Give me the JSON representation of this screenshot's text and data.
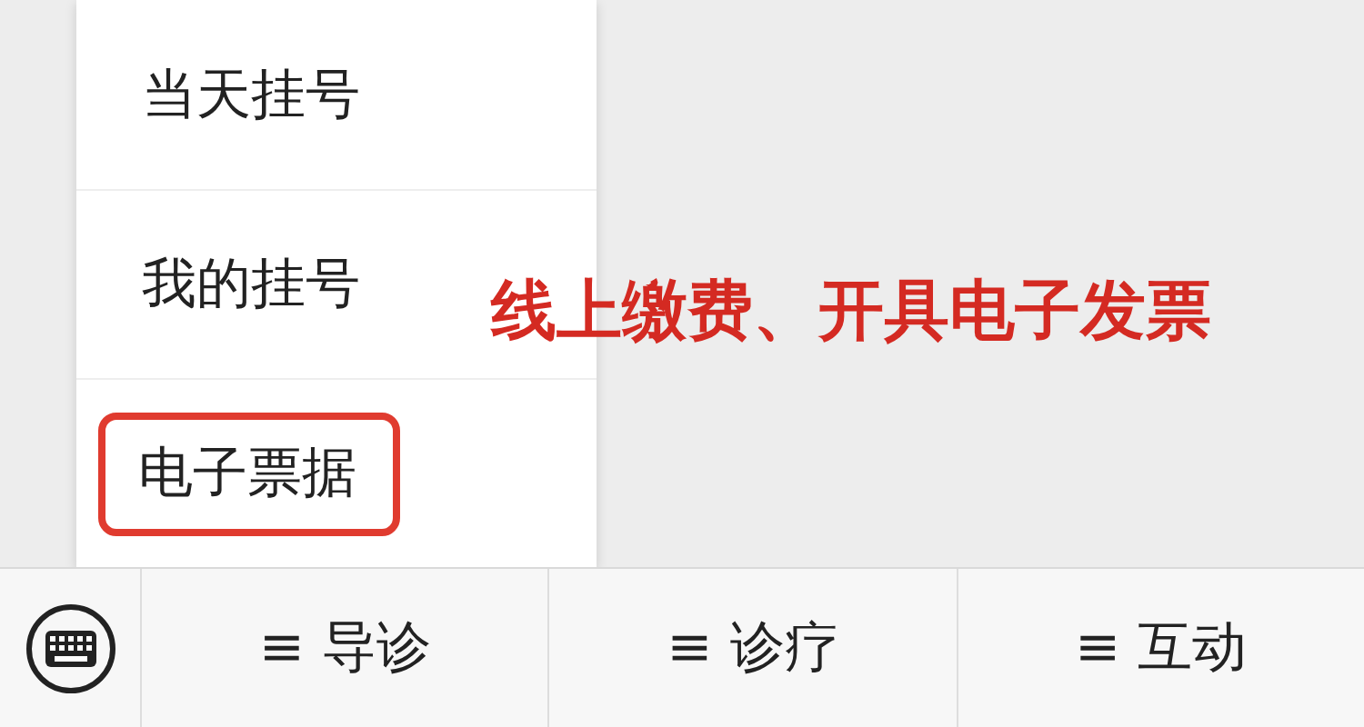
{
  "submenu": {
    "items": [
      {
        "label": "当天挂号",
        "highlighted": false
      },
      {
        "label": "我的挂号",
        "highlighted": false
      },
      {
        "label": "电子票据",
        "highlighted": true
      }
    ]
  },
  "annotation": "线上缴费、开具电子发票",
  "menu_bar": {
    "items": [
      {
        "label": "≡ 导诊"
      },
      {
        "label": "≡ 诊疗"
      },
      {
        "label": "≡ 互动"
      }
    ]
  }
}
